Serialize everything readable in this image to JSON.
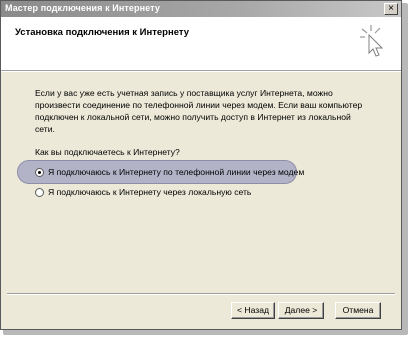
{
  "window": {
    "title": "Мастер подключения к Интернету",
    "close_glyph": "×"
  },
  "header": {
    "title": "Установка подключения к Интернету",
    "logo_icon": "connection-wizard-icon"
  },
  "content": {
    "description": "Если у вас уже есть учетная запись у поставщика услуг Интернета, можно произвести соединение по телефонной линии через модем. Если ваш компьютер подключен к локальной сети, можно получить доступ в Интернет из локальной сети.",
    "question": "Как вы подключаетесь к Интернету?",
    "options": [
      {
        "label": "Я подключаюсь к Интернету по телефонной линии через модем",
        "selected": true
      },
      {
        "label": "Я подключаюсь к Интернету через локальную сеть",
        "selected": false
      }
    ]
  },
  "buttons": {
    "back": "< Назад",
    "next": "Далее >",
    "cancel": "Отмена"
  }
}
